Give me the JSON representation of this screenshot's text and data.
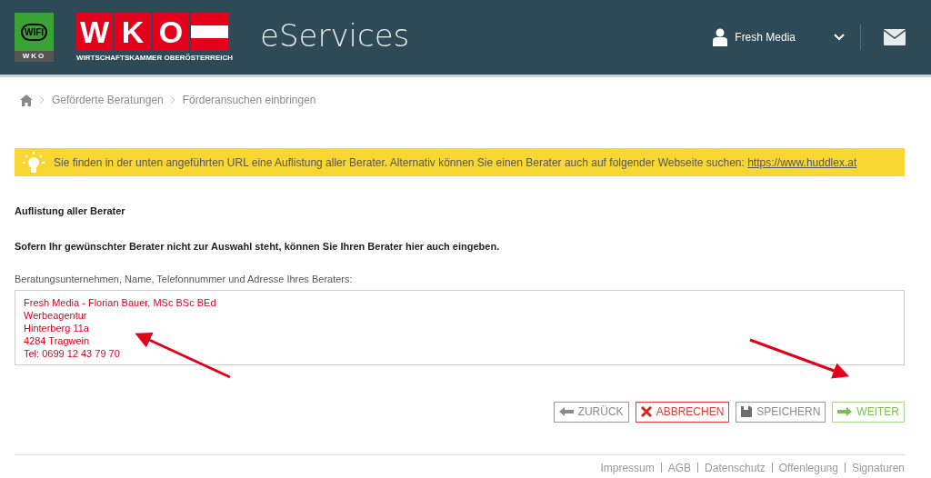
{
  "header": {
    "logo_small": {
      "top": "WIFI",
      "bottom": "WKO"
    },
    "logo_main": {
      "letters": [
        "W",
        "K",
        "O"
      ],
      "subtitle": "WIRTSCHAFTSKAMMER OBERÖSTERREICH"
    },
    "title": "eServices",
    "user": "Fresh Media"
  },
  "breadcrumb": [
    "Geförderte Beratungen",
    "Förderansuchen einbringen"
  ],
  "notice": {
    "text": "Sie finden in der unten angeführten URL eine Auflistung aller Berater. Alternativ können Sie einen Berater auch auf folgender Webseite suchen:",
    "link": "https://www.huddlex.at"
  },
  "section_title": "Auflistung aller Berater",
  "instruction": "Sofern Ihr gewünschter Berater nicht zur Auswahl steht, können Sie Ihren Berater hier auch eingeben.",
  "field": {
    "label": "Beratungsunternehmen, Name, Telefonnummer und Adresse Ihres Beraters:",
    "value": [
      "Fresh Media - Florian Bauer, MSc BSc BEd",
      "Werbeagentur",
      "Hinterberg 11a",
      "4284 Tragwein",
      "Tel: 0699 12 43 79 70"
    ]
  },
  "buttons": [
    {
      "kind": "back",
      "label": "ZURÜCK"
    },
    {
      "kind": "cancel",
      "label": "ABBRECHEN"
    },
    {
      "kind": "save",
      "label": "SPEICHERN"
    },
    {
      "kind": "next",
      "label": "WEITER"
    }
  ],
  "footer": [
    "Impressum",
    "AGB",
    "Datenschutz",
    "Offenlegung",
    "Signaturen"
  ]
}
